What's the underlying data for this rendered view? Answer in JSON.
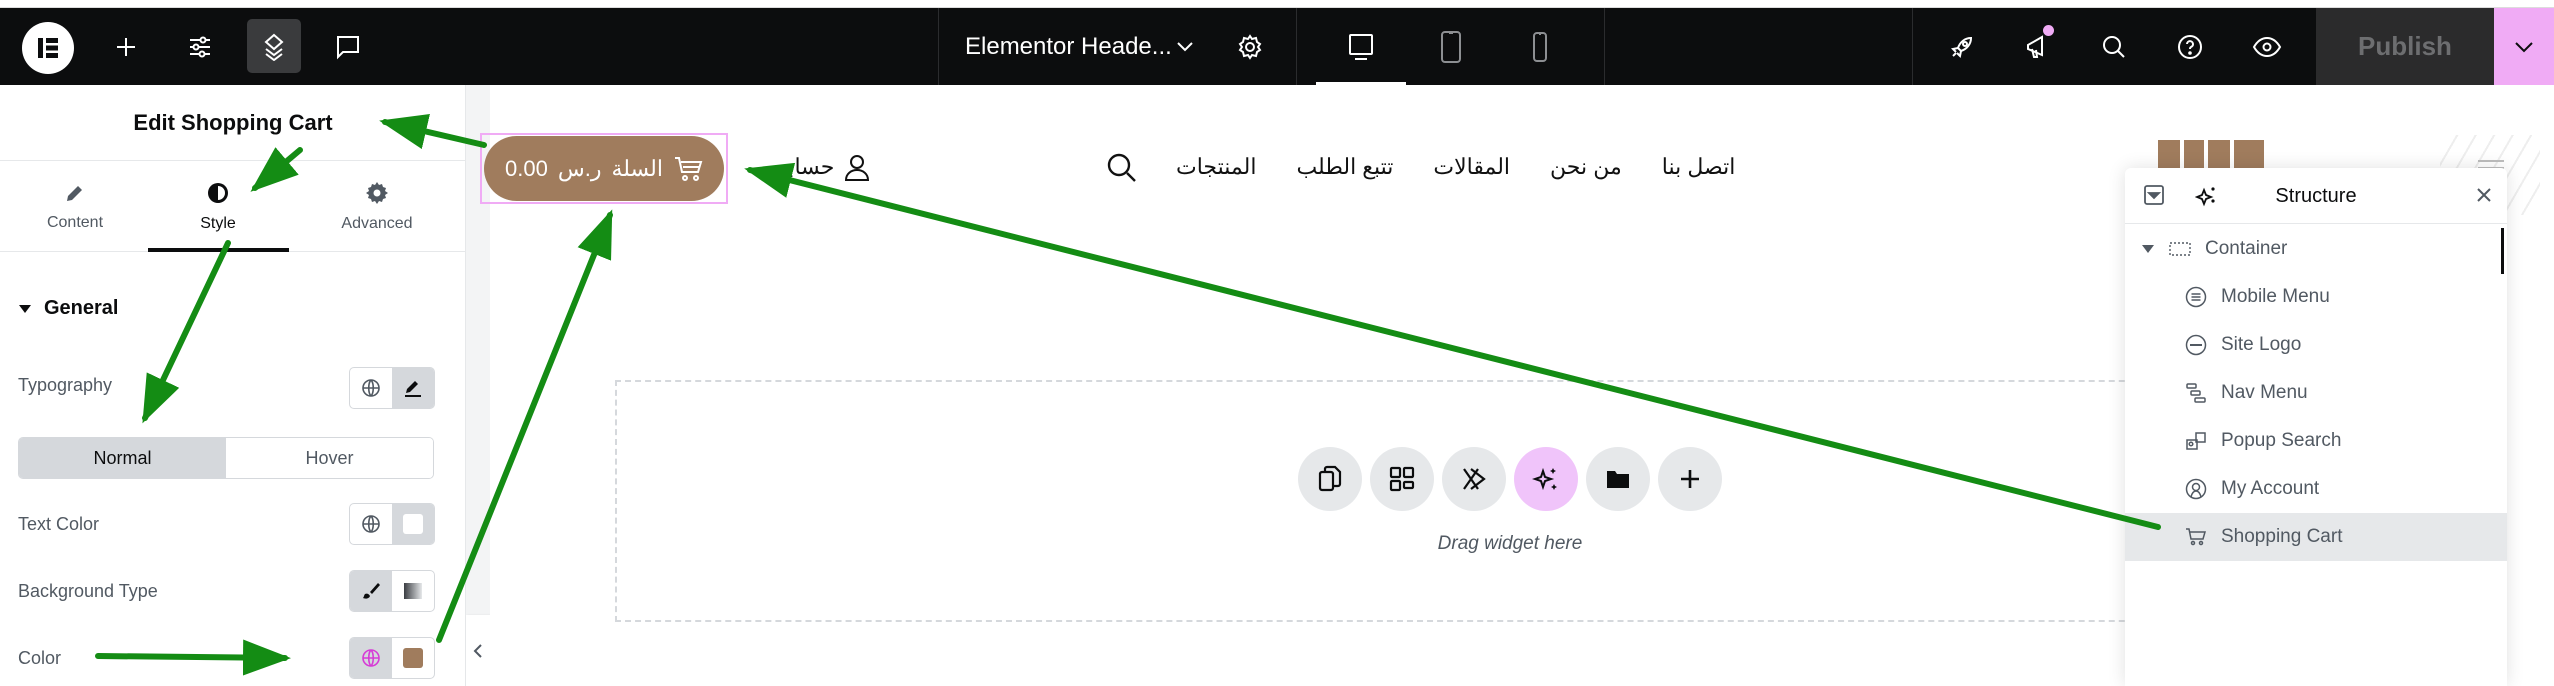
{
  "topbar": {
    "document_title": "Elementor Heade...",
    "publish_label": "Publish",
    "left_icons": [
      "elementor-logo",
      "add-element",
      "site-settings",
      "structure-layers",
      "comments"
    ],
    "devices": [
      "desktop",
      "tablet",
      "mobile"
    ],
    "active_device": "desktop",
    "right_icons": [
      "launch-rocket",
      "whats-new-megaphone",
      "finder-search",
      "help",
      "preview-eye"
    ],
    "accent_color": "#f0abf5"
  },
  "panel": {
    "title": "Edit Shopping Cart",
    "tabs": [
      {
        "label": "Content",
        "icon": "pencil-icon",
        "active": false
      },
      {
        "label": "Style",
        "icon": "contrast-icon",
        "active": true
      },
      {
        "label": "Advanced",
        "icon": "gear-icon",
        "active": false
      }
    ],
    "section_title": "General",
    "controls": {
      "typography_label": "Typography",
      "state_tabs": [
        {
          "label": "Normal",
          "active": true
        },
        {
          "label": "Hover",
          "active": false
        }
      ],
      "text_color_label": "Text Color",
      "text_color_value": "#ffffff",
      "background_type_label": "Background Type",
      "color_label": "Color",
      "color_value": "#a07c5d",
      "global_active_color": "#d63cd6"
    }
  },
  "canvas": {
    "cart_button": {
      "label": "السلة",
      "currency": "ر.س",
      "amount": "0.00",
      "background": "#a07c5d"
    },
    "account_label": "حسابي",
    "nav_items": [
      "المنتجات",
      "تتبع الطلب",
      "المقالات",
      "من نحن",
      "اتصل بنا"
    ],
    "dropzone": {
      "buttons": [
        "paste-icon",
        "templates-icon",
        "x-kit-icon",
        "ai-sparkle-icon",
        "folder-icon",
        "add-icon"
      ],
      "text": "Drag widget here"
    }
  },
  "structure": {
    "title": "Structure",
    "root": "Container",
    "items": [
      {
        "label": "Mobile Menu",
        "icon": "mobile-menu-icon",
        "selected": false
      },
      {
        "label": "Site Logo",
        "icon": "site-logo-icon",
        "selected": false
      },
      {
        "label": "Nav Menu",
        "icon": "nav-menu-icon",
        "selected": false
      },
      {
        "label": "Popup Search",
        "icon": "popup-search-icon",
        "selected": false
      },
      {
        "label": "My Account",
        "icon": "my-account-icon",
        "selected": false
      },
      {
        "label": "Shopping Cart",
        "icon": "cart-icon",
        "selected": true
      }
    ]
  }
}
